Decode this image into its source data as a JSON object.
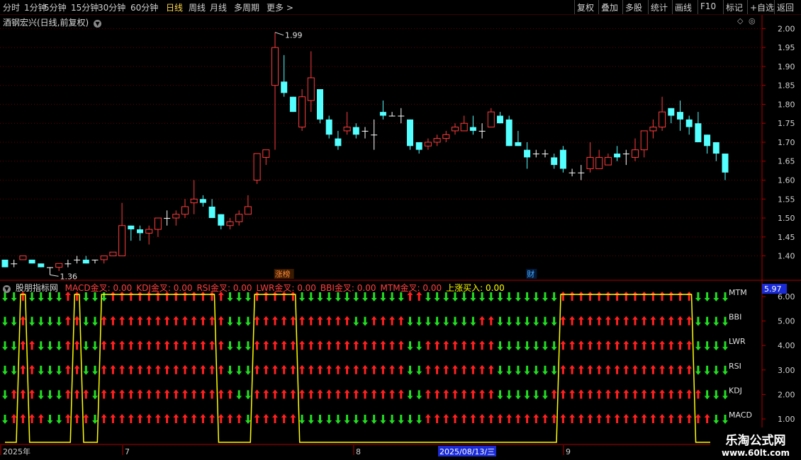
{
  "toolbar": {
    "left_items": [
      "分时",
      "1分钟",
      "5分钟",
      "15分钟",
      "30分钟",
      "60分钟",
      "日线",
      "周线",
      "月线",
      "多周期",
      "更多 >"
    ],
    "active": "日线",
    "right_items": [
      "复权",
      "叠加",
      "多股",
      "统计",
      "画线",
      "F10",
      "标记",
      "+自选",
      "返回"
    ]
  },
  "main_panel": {
    "title": "酒钢宏兴(日线,前复权)",
    "high_label": "1.99",
    "low_label": "1.36",
    "event_tags": [
      "涨榜",
      "财"
    ],
    "y_ticks": [
      "2.00",
      "1.95",
      "1.90",
      "1.85",
      "1.80",
      "1.75",
      "1.70",
      "1.65",
      "1.60",
      "1.55",
      "1.50",
      "1.45",
      "1.40"
    ]
  },
  "indicator_panel": {
    "title": "股朋指标网",
    "legend": [
      {
        "label": "MACD金叉: 0.00",
        "color": "#ff4040"
      },
      {
        "label": "KDJ金叉: 0.00",
        "color": "#ff4040"
      },
      {
        "label": "RSI金叉: 0.00",
        "color": "#ff4040"
      },
      {
        "label": "LWR金叉: 0.00",
        "color": "#ff4040"
      },
      {
        "label": "BBI金叉: 0.00",
        "color": "#ff4040"
      },
      {
        "label": "MTM金叉: 0.00",
        "color": "#ff4040"
      },
      {
        "label": "上涨买入: 0.00",
        "color": "#ffff00"
      }
    ],
    "current_value": "5.97",
    "row_labels": [
      "MTM",
      "BBI",
      "LWR",
      "RSI",
      "KDJ",
      "MACD"
    ],
    "y_ticks": [
      "6.00",
      "5.00",
      "4.00",
      "3.00",
      "2.00",
      "1.00"
    ]
  },
  "date_axis": {
    "labels": [
      "2025年",
      "7",
      "8",
      "2025/08/13/三",
      "9"
    ]
  },
  "watermark": {
    "line1": "乐淘公式网",
    "line2": "www.60lt.com"
  },
  "chart_data": {
    "type": "candlestick",
    "open": [
      1.39,
      1.38,
      1.39,
      1.39,
      1.38,
      1.37,
      1.37,
      1.38,
      1.39,
      1.39,
      1.39,
      1.39,
      1.4,
      1.4,
      1.48,
      1.47,
      1.46,
      1.47,
      1.5,
      1.5,
      1.51,
      1.54,
      1.55,
      1.53,
      1.51,
      1.48,
      1.49,
      1.51,
      1.6,
      1.66,
      1.85,
      1.86,
      1.82,
      1.74,
      1.81,
      1.84,
      1.76,
      1.71,
      1.73,
      1.74,
      1.73,
      1.72,
      1.78,
      1.77,
      1.77,
      1.76,
      1.7,
      1.69,
      1.7,
      1.71,
      1.73,
      1.73,
      1.74,
      1.73,
      1.74,
      1.77,
      1.76,
      1.7,
      1.68,
      1.67,
      1.67,
      1.66,
      1.68,
      1.62,
      1.62,
      1.63,
      1.63,
      1.64,
      1.67,
      1.67,
      1.66,
      1.68,
      1.73,
      1.74,
      1.79,
      1.78,
      1.76,
      1.75,
      1.72,
      1.7,
      1.67
    ],
    "close": [
      1.37,
      1.38,
      1.4,
      1.38,
      1.37,
      1.37,
      1.38,
      1.38,
      1.39,
      1.38,
      1.39,
      1.4,
      1.41,
      1.48,
      1.47,
      1.46,
      1.47,
      1.5,
      1.5,
      1.51,
      1.53,
      1.55,
      1.54,
      1.5,
      1.48,
      1.49,
      1.51,
      1.53,
      1.67,
      1.68,
      1.95,
      1.83,
      1.78,
      1.82,
      1.87,
      1.76,
      1.72,
      1.69,
      1.74,
      1.72,
      1.73,
      1.72,
      1.77,
      1.77,
      1.77,
      1.69,
      1.68,
      1.7,
      1.71,
      1.72,
      1.74,
      1.75,
      1.73,
      1.73,
      1.78,
      1.75,
      1.69,
      1.69,
      1.66,
      1.67,
      1.67,
      1.64,
      1.63,
      1.62,
      1.62,
      1.66,
      1.66,
      1.66,
      1.66,
      1.67,
      1.68,
      1.73,
      1.74,
      1.78,
      1.77,
      1.76,
      1.74,
      1.7,
      1.69,
      1.67,
      1.62
    ],
    "high": [
      1.39,
      1.39,
      1.4,
      1.39,
      1.38,
      1.37,
      1.38,
      1.39,
      1.4,
      1.4,
      1.39,
      1.4,
      1.41,
      1.54,
      1.48,
      1.48,
      1.48,
      1.5,
      1.52,
      1.52,
      1.55,
      1.6,
      1.56,
      1.55,
      1.51,
      1.5,
      1.52,
      1.56,
      1.67,
      1.68,
      1.99,
      1.93,
      1.82,
      1.84,
      1.94,
      1.82,
      1.77,
      1.73,
      1.78,
      1.75,
      1.74,
      1.76,
      1.81,
      1.78,
      1.79,
      1.76,
      1.7,
      1.71,
      1.72,
      1.73,
      1.75,
      1.77,
      1.77,
      1.75,
      1.79,
      1.78,
      1.77,
      1.73,
      1.7,
      1.68,
      1.68,
      1.67,
      1.69,
      1.63,
      1.64,
      1.7,
      1.68,
      1.67,
      1.69,
      1.68,
      1.71,
      1.73,
      1.76,
      1.82,
      1.79,
      1.81,
      1.77,
      1.78,
      1.72,
      1.7,
      1.66
    ],
    "low": [
      1.37,
      1.37,
      1.39,
      1.38,
      1.37,
      1.35,
      1.36,
      1.37,
      1.38,
      1.38,
      1.38,
      1.38,
      1.4,
      1.4,
      1.44,
      1.44,
      1.43,
      1.45,
      1.48,
      1.48,
      1.5,
      1.51,
      1.53,
      1.5,
      1.47,
      1.47,
      1.48,
      1.51,
      1.59,
      1.64,
      1.68,
      1.82,
      1.78,
      1.73,
      1.78,
      1.75,
      1.71,
      1.68,
      1.72,
      1.71,
      1.71,
      1.68,
      1.76,
      1.77,
      1.75,
      1.68,
      1.67,
      1.68,
      1.69,
      1.7,
      1.72,
      1.73,
      1.72,
      1.71,
      1.74,
      1.75,
      1.69,
      1.69,
      1.63,
      1.66,
      1.66,
      1.63,
      1.62,
      1.61,
      1.6,
      1.62,
      1.63,
      1.64,
      1.65,
      1.64,
      1.65,
      1.66,
      1.71,
      1.73,
      1.75,
      1.73,
      1.72,
      1.7,
      1.67,
      1.65,
      1.6
    ],
    "ylim": [
      1.36,
      2.01
    ],
    "indicator_signals": {
      "MTM": [
        0,
        0,
        1,
        0,
        0,
        0,
        0,
        1,
        1,
        0,
        0,
        0,
        1,
        1,
        1,
        1,
        1,
        1,
        1,
        1,
        1,
        1,
        1,
        1,
        1,
        0,
        0,
        0,
        1,
        1,
        1,
        1,
        1,
        0,
        0,
        0,
        0,
        0,
        0,
        0,
        0,
        0,
        0,
        0,
        0,
        1,
        1,
        0,
        0,
        0,
        0,
        0,
        0,
        0,
        0,
        0,
        0,
        0,
        0,
        0,
        0,
        0,
        1,
        1,
        1,
        1,
        1,
        1,
        1,
        1,
        1,
        1,
        1,
        1,
        1,
        1,
        1,
        0,
        0,
        0,
        0
      ],
      "BBI": [
        0,
        0,
        1,
        0,
        0,
        0,
        0,
        1,
        1,
        0,
        0,
        1,
        1,
        1,
        1,
        1,
        1,
        1,
        1,
        1,
        1,
        1,
        1,
        1,
        1,
        0,
        0,
        0,
        1,
        1,
        1,
        1,
        1,
        1,
        1,
        1,
        1,
        1,
        1,
        0,
        0,
        1,
        1,
        1,
        1,
        0,
        0,
        0,
        0,
        0,
        0,
        0,
        0,
        1,
        1,
        0,
        0,
        0,
        0,
        0,
        0,
        0,
        1,
        1,
        1,
        1,
        1,
        1,
        1,
        1,
        1,
        1,
        1,
        1,
        1,
        1,
        1,
        0,
        0,
        0,
        0
      ],
      "LWR": [
        0,
        0,
        1,
        1,
        0,
        0,
        0,
        1,
        1,
        0,
        0,
        1,
        1,
        1,
        1,
        1,
        1,
        1,
        1,
        1,
        1,
        1,
        1,
        1,
        1,
        0,
        0,
        0,
        1,
        1,
        1,
        1,
        1,
        1,
        1,
        1,
        1,
        1,
        1,
        1,
        1,
        1,
        1,
        1,
        1,
        0,
        0,
        1,
        1,
        1,
        1,
        1,
        1,
        1,
        1,
        0,
        0,
        0,
        0,
        0,
        0,
        0,
        1,
        1,
        1,
        1,
        1,
        1,
        1,
        1,
        1,
        1,
        1,
        1,
        1,
        1,
        1,
        0,
        0,
        0,
        0
      ],
      "RSI": [
        0,
        0,
        1,
        1,
        0,
        0,
        0,
        1,
        1,
        0,
        0,
        1,
        1,
        1,
        1,
        1,
        1,
        1,
        1,
        1,
        1,
        1,
        1,
        1,
        1,
        0,
        0,
        0,
        1,
        1,
        1,
        1,
        1,
        1,
        1,
        1,
        1,
        1,
        1,
        1,
        1,
        1,
        1,
        1,
        1,
        0,
        0,
        1,
        1,
        1,
        1,
        1,
        1,
        1,
        1,
        0,
        0,
        0,
        0,
        0,
        0,
        0,
        1,
        1,
        1,
        1,
        1,
        1,
        1,
        1,
        1,
        1,
        1,
        1,
        1,
        1,
        1,
        0,
        0,
        0,
        0
      ],
      "KDJ": [
        0,
        1,
        1,
        1,
        0,
        0,
        0,
        1,
        1,
        1,
        0,
        1,
        1,
        1,
        1,
        1,
        1,
        1,
        1,
        1,
        1,
        1,
        1,
        1,
        1,
        1,
        0,
        0,
        1,
        1,
        1,
        1,
        1,
        1,
        1,
        1,
        1,
        1,
        1,
        1,
        1,
        1,
        1,
        1,
        1,
        0,
        0,
        1,
        1,
        1,
        1,
        1,
        1,
        1,
        1,
        0,
        0,
        0,
        0,
        0,
        0,
        1,
        1,
        1,
        1,
        1,
        1,
        1,
        1,
        1,
        1,
        1,
        1,
        1,
        1,
        1,
        1,
        1,
        0,
        0,
        0
      ],
      "MACD": [
        0,
        1,
        1,
        1,
        1,
        0,
        0,
        1,
        1,
        1,
        0,
        1,
        1,
        1,
        1,
        1,
        1,
        1,
        1,
        1,
        1,
        1,
        1,
        1,
        1,
        1,
        1,
        0,
        1,
        1,
        1,
        1,
        1,
        0,
        0,
        0,
        0,
        0,
        0,
        0,
        0,
        0,
        0,
        0,
        0,
        0,
        0,
        1,
        1,
        1,
        1,
        1,
        1,
        1,
        1,
        1,
        1,
        1,
        1,
        1,
        1,
        1,
        1,
        1,
        1,
        1,
        1,
        1,
        1,
        1,
        1,
        1,
        1,
        1,
        1,
        1,
        1,
        1,
        1,
        0,
        0
      ]
    },
    "buy_signal": [
      0,
      0,
      1,
      0,
      0,
      0,
      0,
      0,
      1,
      0,
      0,
      1,
      1,
      1,
      1,
      1,
      1,
      1,
      1,
      1,
      1,
      1,
      1,
      1,
      0,
      0,
      0,
      0,
      1,
      1,
      1,
      1,
      1,
      0,
      0,
      0,
      0,
      0,
      0,
      0,
      0,
      0,
      0,
      0,
      0,
      0,
      0,
      0,
      0,
      0,
      0,
      0,
      0,
      0,
      0,
      0,
      0,
      0,
      0,
      0,
      0,
      0,
      1,
      1,
      1,
      1,
      1,
      1,
      1,
      1,
      1,
      1,
      1,
      1,
      1,
      1,
      1,
      0,
      0,
      0,
      0
    ]
  }
}
